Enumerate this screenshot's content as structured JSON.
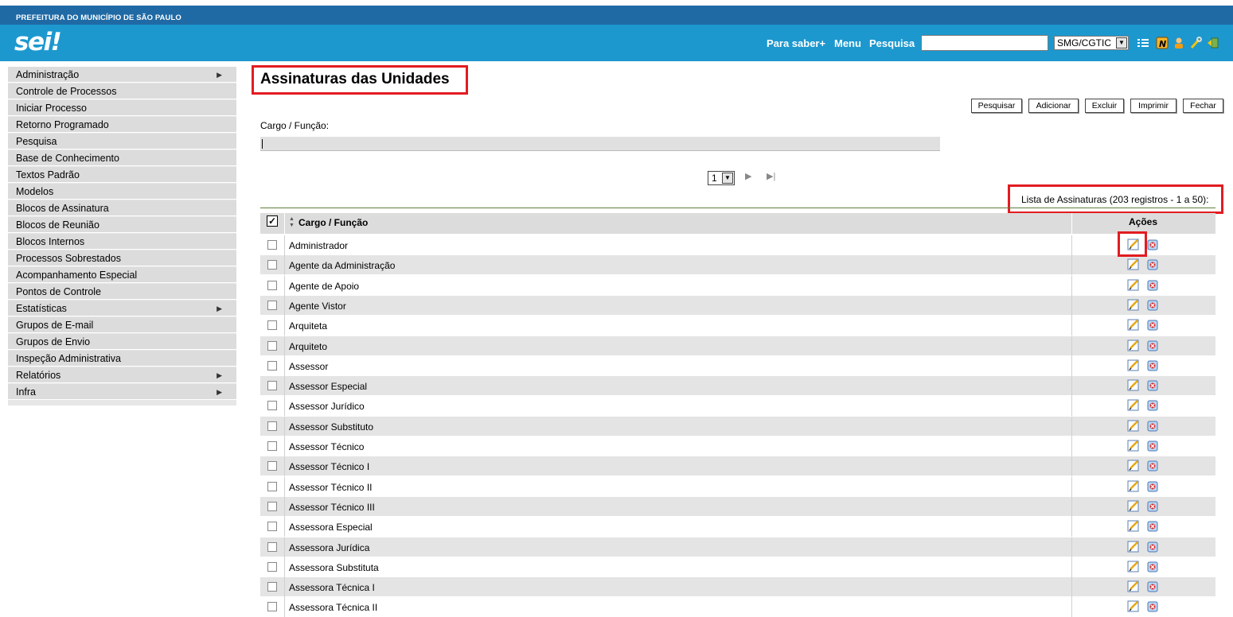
{
  "header": {
    "org": "PREFEITURA DO MUNICÍPIO DE SÃO PAULO",
    "logo": "sei!",
    "nav": [
      "Para saber+",
      "Menu",
      "Pesquisa"
    ],
    "search_value": "",
    "unit": "SMG/CGTIC",
    "icons": [
      "list-icon",
      "notes-icon",
      "user-icon",
      "tools-icon",
      "exit-icon"
    ]
  },
  "sidebar": {
    "items": [
      {
        "label": "Administração",
        "submenu": true
      },
      {
        "label": "Controle de Processos",
        "submenu": false
      },
      {
        "label": "Iniciar Processo",
        "submenu": false
      },
      {
        "label": "Retorno Programado",
        "submenu": false
      },
      {
        "label": "Pesquisa",
        "submenu": false
      },
      {
        "label": "Base de Conhecimento",
        "submenu": false
      },
      {
        "label": "Textos Padrão",
        "submenu": false
      },
      {
        "label": "Modelos",
        "submenu": false
      },
      {
        "label": "Blocos de Assinatura",
        "submenu": false
      },
      {
        "label": "Blocos de Reunião",
        "submenu": false
      },
      {
        "label": "Blocos Internos",
        "submenu": false
      },
      {
        "label": "Processos Sobrestados",
        "submenu": false
      },
      {
        "label": "Acompanhamento Especial",
        "submenu": false
      },
      {
        "label": "Pontos de Controle",
        "submenu": false
      },
      {
        "label": "Estatísticas",
        "submenu": true
      },
      {
        "label": "Grupos de E-mail",
        "submenu": false
      },
      {
        "label": "Grupos de Envio",
        "submenu": false
      },
      {
        "label": "Inspeção Administrativa",
        "submenu": false
      },
      {
        "label": "Relatórios",
        "submenu": true
      },
      {
        "label": "Infra",
        "submenu": true
      }
    ]
  },
  "main": {
    "title": "Assinaturas das Unidades",
    "buttons": [
      "Pesquisar",
      "Adicionar",
      "Excluir",
      "Imprimir",
      "Fechar"
    ],
    "filter_label": "Cargo / Função:",
    "filter_value": "",
    "page": "1",
    "caption": "Lista de Assinaturas (203 registros - 1 a 50):",
    "columns": {
      "name": "Cargo / Função",
      "actions": "Ações"
    },
    "rows": [
      "Administrador",
      "Agente da Administração",
      "Agente de Apoio",
      "Agente Vistor",
      "Arquiteta",
      "Arquiteto",
      "Assessor",
      "Assessor Especial",
      "Assessor Jurídico",
      "Assessor Substituto",
      "Assessor Técnico",
      "Assessor Técnico I",
      "Assessor Técnico II",
      "Assessor Técnico III",
      "Assessora Especial",
      "Assessora Jurídica",
      "Assessora Substituta",
      "Assessora Técnica I",
      "Assessora Técnica II"
    ]
  },
  "colors": {
    "header_dark": "#1f6aa5",
    "header_light": "#1c98cf",
    "highlight": "#e21c21"
  }
}
